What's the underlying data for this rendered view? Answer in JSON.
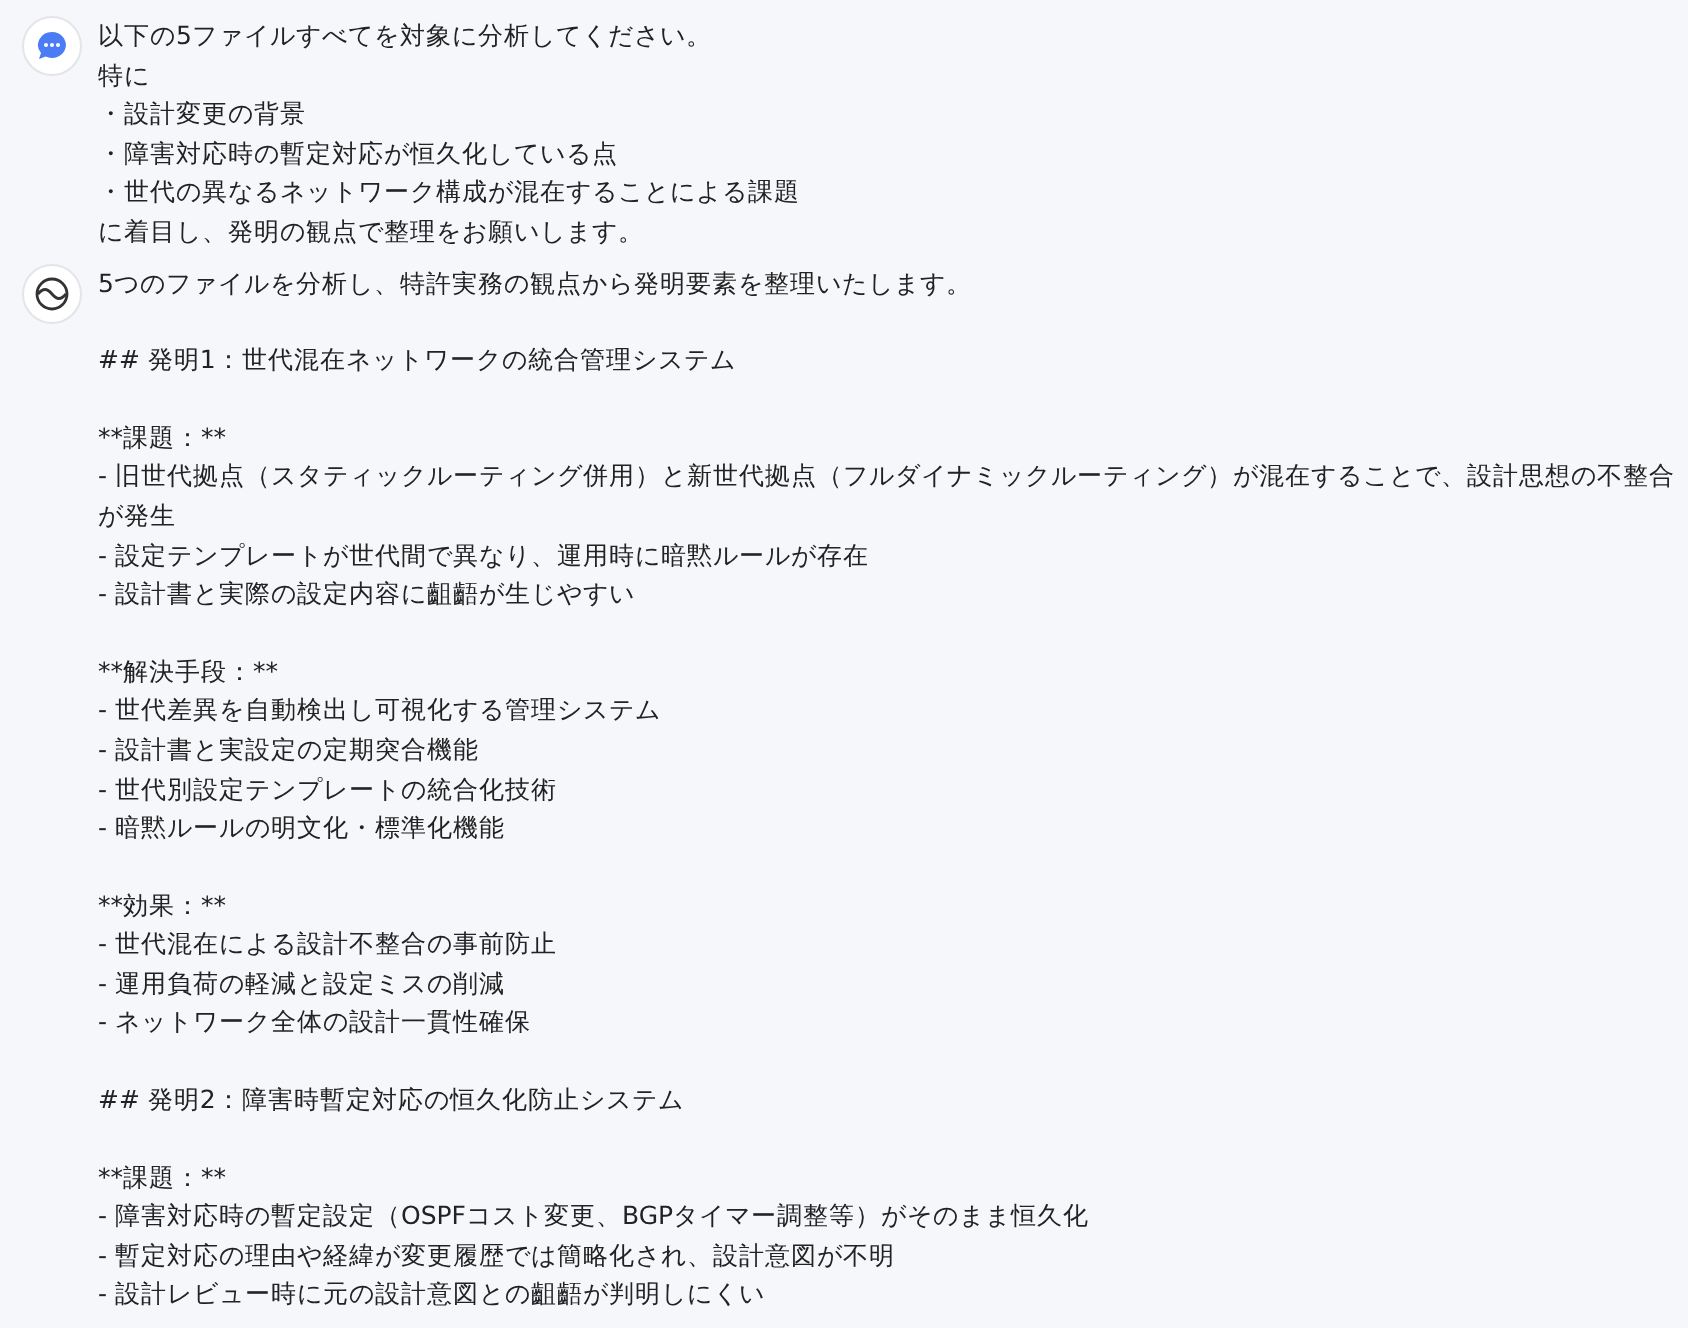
{
  "messages": [
    {
      "kind": "user",
      "blocks": [
        [
          "以下の5ファイルすべてを対象に分析してください。",
          "特に",
          "・設計変更の背景",
          "・障害対応時の暫定対応が恒久化している点",
          "・世代の異なるネットワーク構成が混在することによる課題",
          "に着目し、発明の観点で整理をお願いします。"
        ]
      ]
    },
    {
      "kind": "assistant",
      "blocks": [
        [
          "5つのファイルを分析し、特許実務の観点から発明要素を整理いたします。"
        ],
        [
          "## 発明1：世代混在ネットワークの統合管理システム"
        ],
        [
          "**課題：**",
          "- 旧世代拠点（スタティックルーティング併用）と新世代拠点（フルダイナミックルーティング）が混在することで、設計思想の不整合が発生",
          "- 設定テンプレートが世代間で異なり、運用時に暗黙ルールが存在",
          "- 設計書と実際の設定内容に齟齬が生じやすい"
        ],
        [
          "**解決手段：**",
          "- 世代差異を自動検出し可視化する管理システム",
          "- 設計書と実設定の定期突合機能",
          "- 世代別設定テンプレートの統合化技術",
          "- 暗黙ルールの明文化・標準化機能"
        ],
        [
          "**効果：**",
          "- 世代混在による設計不整合の事前防止",
          "- 運用負荷の軽減と設定ミスの削減",
          "- ネットワーク全体の設計一貫性確保"
        ],
        [
          "## 発明2：障害時暫定対応の恒久化防止システム"
        ],
        [
          "**課題：**",
          "- 障害対応時の暫定設定（OSPFコスト変更、BGPタイマー調整等）がそのまま恒久化",
          "- 暫定対応の理由や経緯が変更履歴では簡略化され、設計意図が不明",
          "- 設計レビュー時に元の設計意図との齟齬が判明しにくい"
        ]
      ]
    }
  ]
}
